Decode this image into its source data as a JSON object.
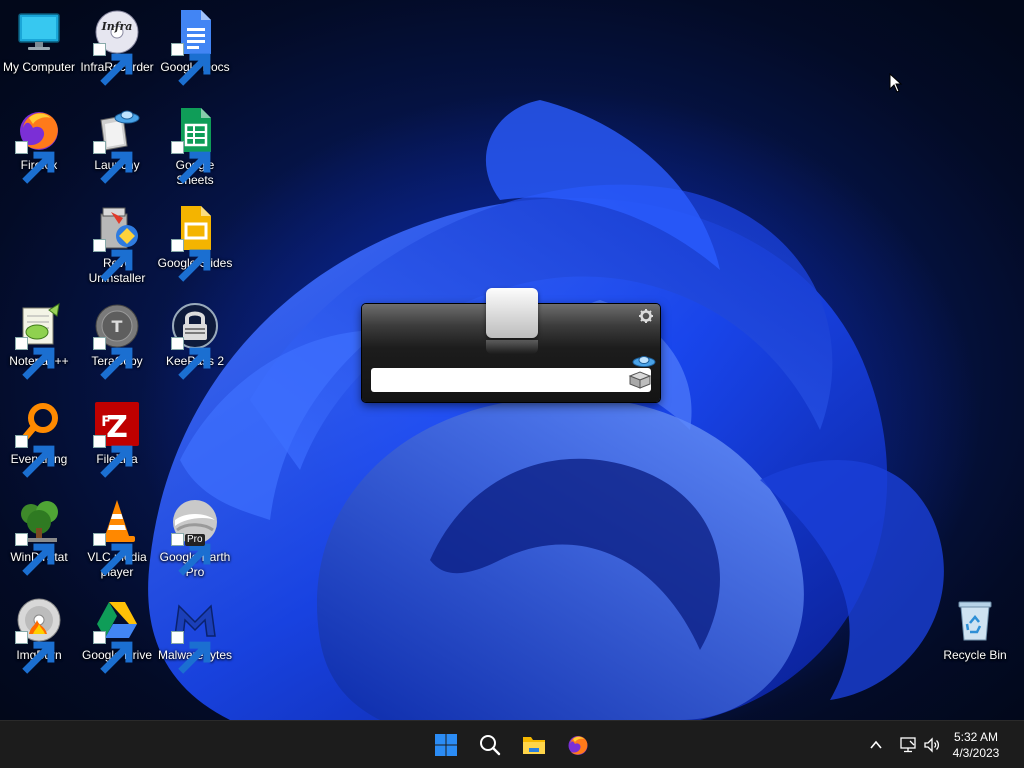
{
  "desktop": {
    "icons": [
      {
        "label": "My Computer",
        "icon": "monitor-icon"
      },
      {
        "label": "InfraRecorder",
        "icon": "disc-infrarecorder-icon"
      },
      {
        "label": "Google Docs",
        "icon": "google-docs-icon"
      },
      {
        "label": "Firefox",
        "icon": "firefox-icon"
      },
      {
        "label": "Launchy",
        "icon": "launchy-icon"
      },
      {
        "label": "Google Sheets",
        "icon": "google-sheets-icon"
      },
      {
        "label": "Revo Uninstaller",
        "icon": "revo-uninstaller-icon"
      },
      {
        "label": "Google Slides",
        "icon": "google-slides-icon"
      },
      {
        "label": "Notepad++",
        "icon": "notepadpp-icon"
      },
      {
        "label": "TeraCopy",
        "icon": "teracopy-icon"
      },
      {
        "label": "KeePass 2",
        "icon": "keepass-lock-icon"
      },
      {
        "label": "Everything",
        "icon": "everything-search-icon"
      },
      {
        "label": "FileZilla",
        "icon": "filezilla-icon"
      },
      {
        "label": "WinDirStat",
        "icon": "windirstat-tree-icon"
      },
      {
        "label": "VLC media player",
        "icon": "vlc-cone-icon"
      },
      {
        "label": "Google Earth Pro",
        "icon": "google-earth-icon",
        "badge": "Pro"
      },
      {
        "label": "ImgBurn",
        "icon": "imgburn-disc-icon"
      },
      {
        "label": "Google Drive",
        "icon": "google-drive-icon"
      },
      {
        "label": "Malwarebytes",
        "icon": "malwarebytes-icon"
      },
      {
        "label": "Recycle Bin",
        "icon": "recycle-bin-icon"
      }
    ]
  },
  "launchy": {
    "input_value": "",
    "colors": {
      "accent": "#ffffff",
      "body": "#1c1c1c"
    }
  },
  "taskbar": {
    "buttons": [
      {
        "name": "start",
        "icon": "windows-start-icon"
      },
      {
        "name": "search",
        "icon": "search-icon"
      },
      {
        "name": "file-explorer",
        "icon": "folder-icon"
      },
      {
        "name": "firefox",
        "icon": "firefox-icon"
      }
    ],
    "tray": {
      "clock_time": "5:32 AM",
      "clock_date": "4/3/2023"
    },
    "colors": {
      "background": "#1c1c1c",
      "start_blue": "#2b8cf5"
    }
  }
}
